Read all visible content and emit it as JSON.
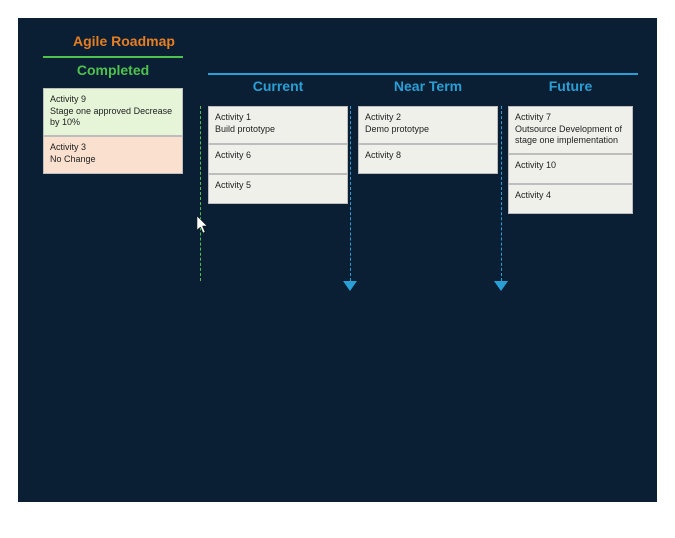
{
  "title": "Agile Roadmap",
  "columns": {
    "completed": {
      "label": "Completed"
    },
    "current": {
      "label": "Current"
    },
    "near": {
      "label": "Near Term"
    },
    "future": {
      "label": "Future"
    }
  },
  "cards": {
    "completed": [
      {
        "title": "Activity 9",
        "body": "Stage one approved\nDecrease by 10%"
      },
      {
        "title": "Activity 3",
        "body": "No Change"
      }
    ],
    "current": [
      {
        "title": "Activity 1",
        "body": "Build prototype"
      },
      {
        "title": "Activity 6",
        "body": ""
      },
      {
        "title": "Activity 5",
        "body": ""
      }
    ],
    "near": [
      {
        "title": "Activity 2",
        "body": "Demo prototype"
      },
      {
        "title": "Activity 8",
        "body": ""
      }
    ],
    "future": [
      {
        "title": "Activity 7",
        "body": "Outsource Development of stage one implementation"
      },
      {
        "title": "Activity 10",
        "body": ""
      },
      {
        "title": "Activity 4",
        "body": ""
      }
    ]
  }
}
